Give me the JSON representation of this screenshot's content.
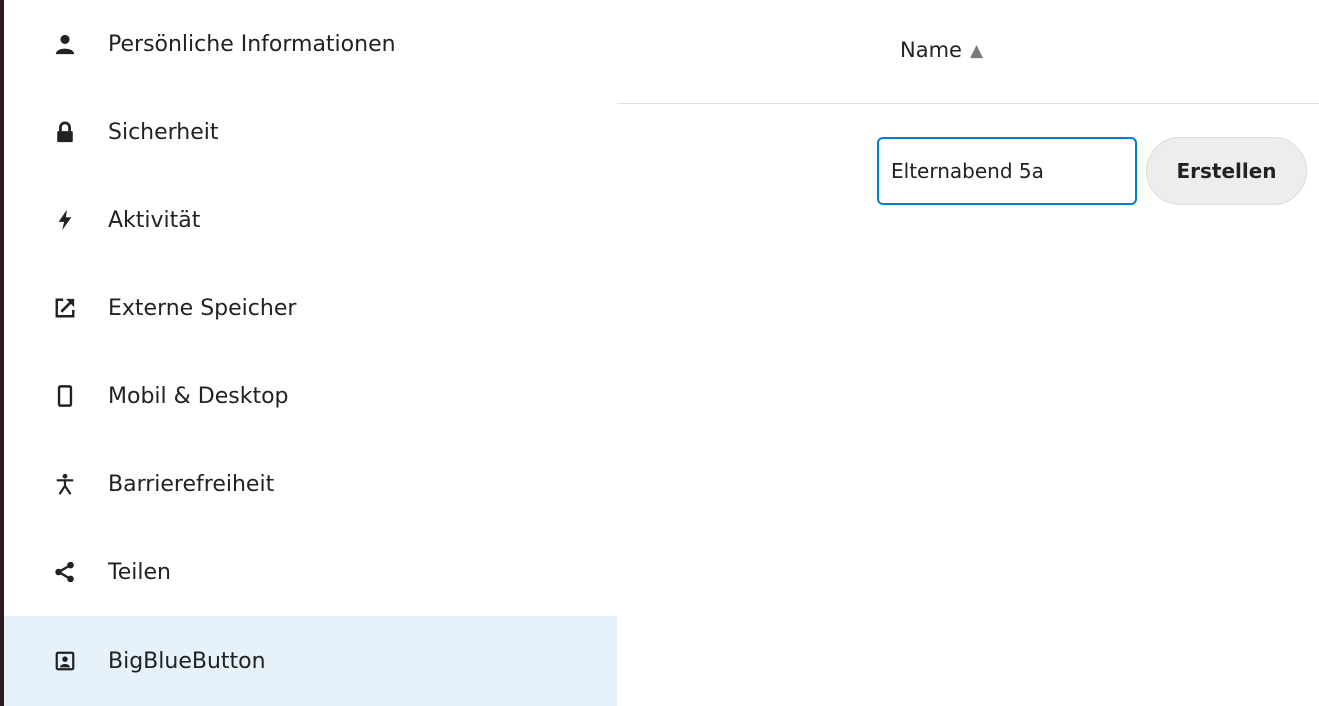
{
  "sidebar": {
    "items": [
      {
        "label": "Persönliche Informationen",
        "icon": "user-icon",
        "active": false
      },
      {
        "label": "Sicherheit",
        "icon": "lock-icon",
        "active": false
      },
      {
        "label": "Aktivität",
        "icon": "flash-icon",
        "active": false
      },
      {
        "label": "Externe Speicher",
        "icon": "external-storage-icon",
        "active": false
      },
      {
        "label": "Mobil & Desktop",
        "icon": "phone-icon",
        "active": false
      },
      {
        "label": "Barrierefreiheit",
        "icon": "accessibility-icon",
        "active": false
      },
      {
        "label": "Teilen",
        "icon": "share-icon",
        "active": false
      },
      {
        "label": "BigBlueButton",
        "icon": "bigbluebutton-icon",
        "active": true
      }
    ],
    "active_background": "#e6f1fa"
  },
  "table": {
    "column_name": "Name",
    "sort_indicator": "▲"
  },
  "create_form": {
    "input_value": "Elternabend 5a",
    "button_label": "Erstellen"
  },
  "colors": {
    "accent": "#0082c9",
    "button_background": "#ededed"
  }
}
